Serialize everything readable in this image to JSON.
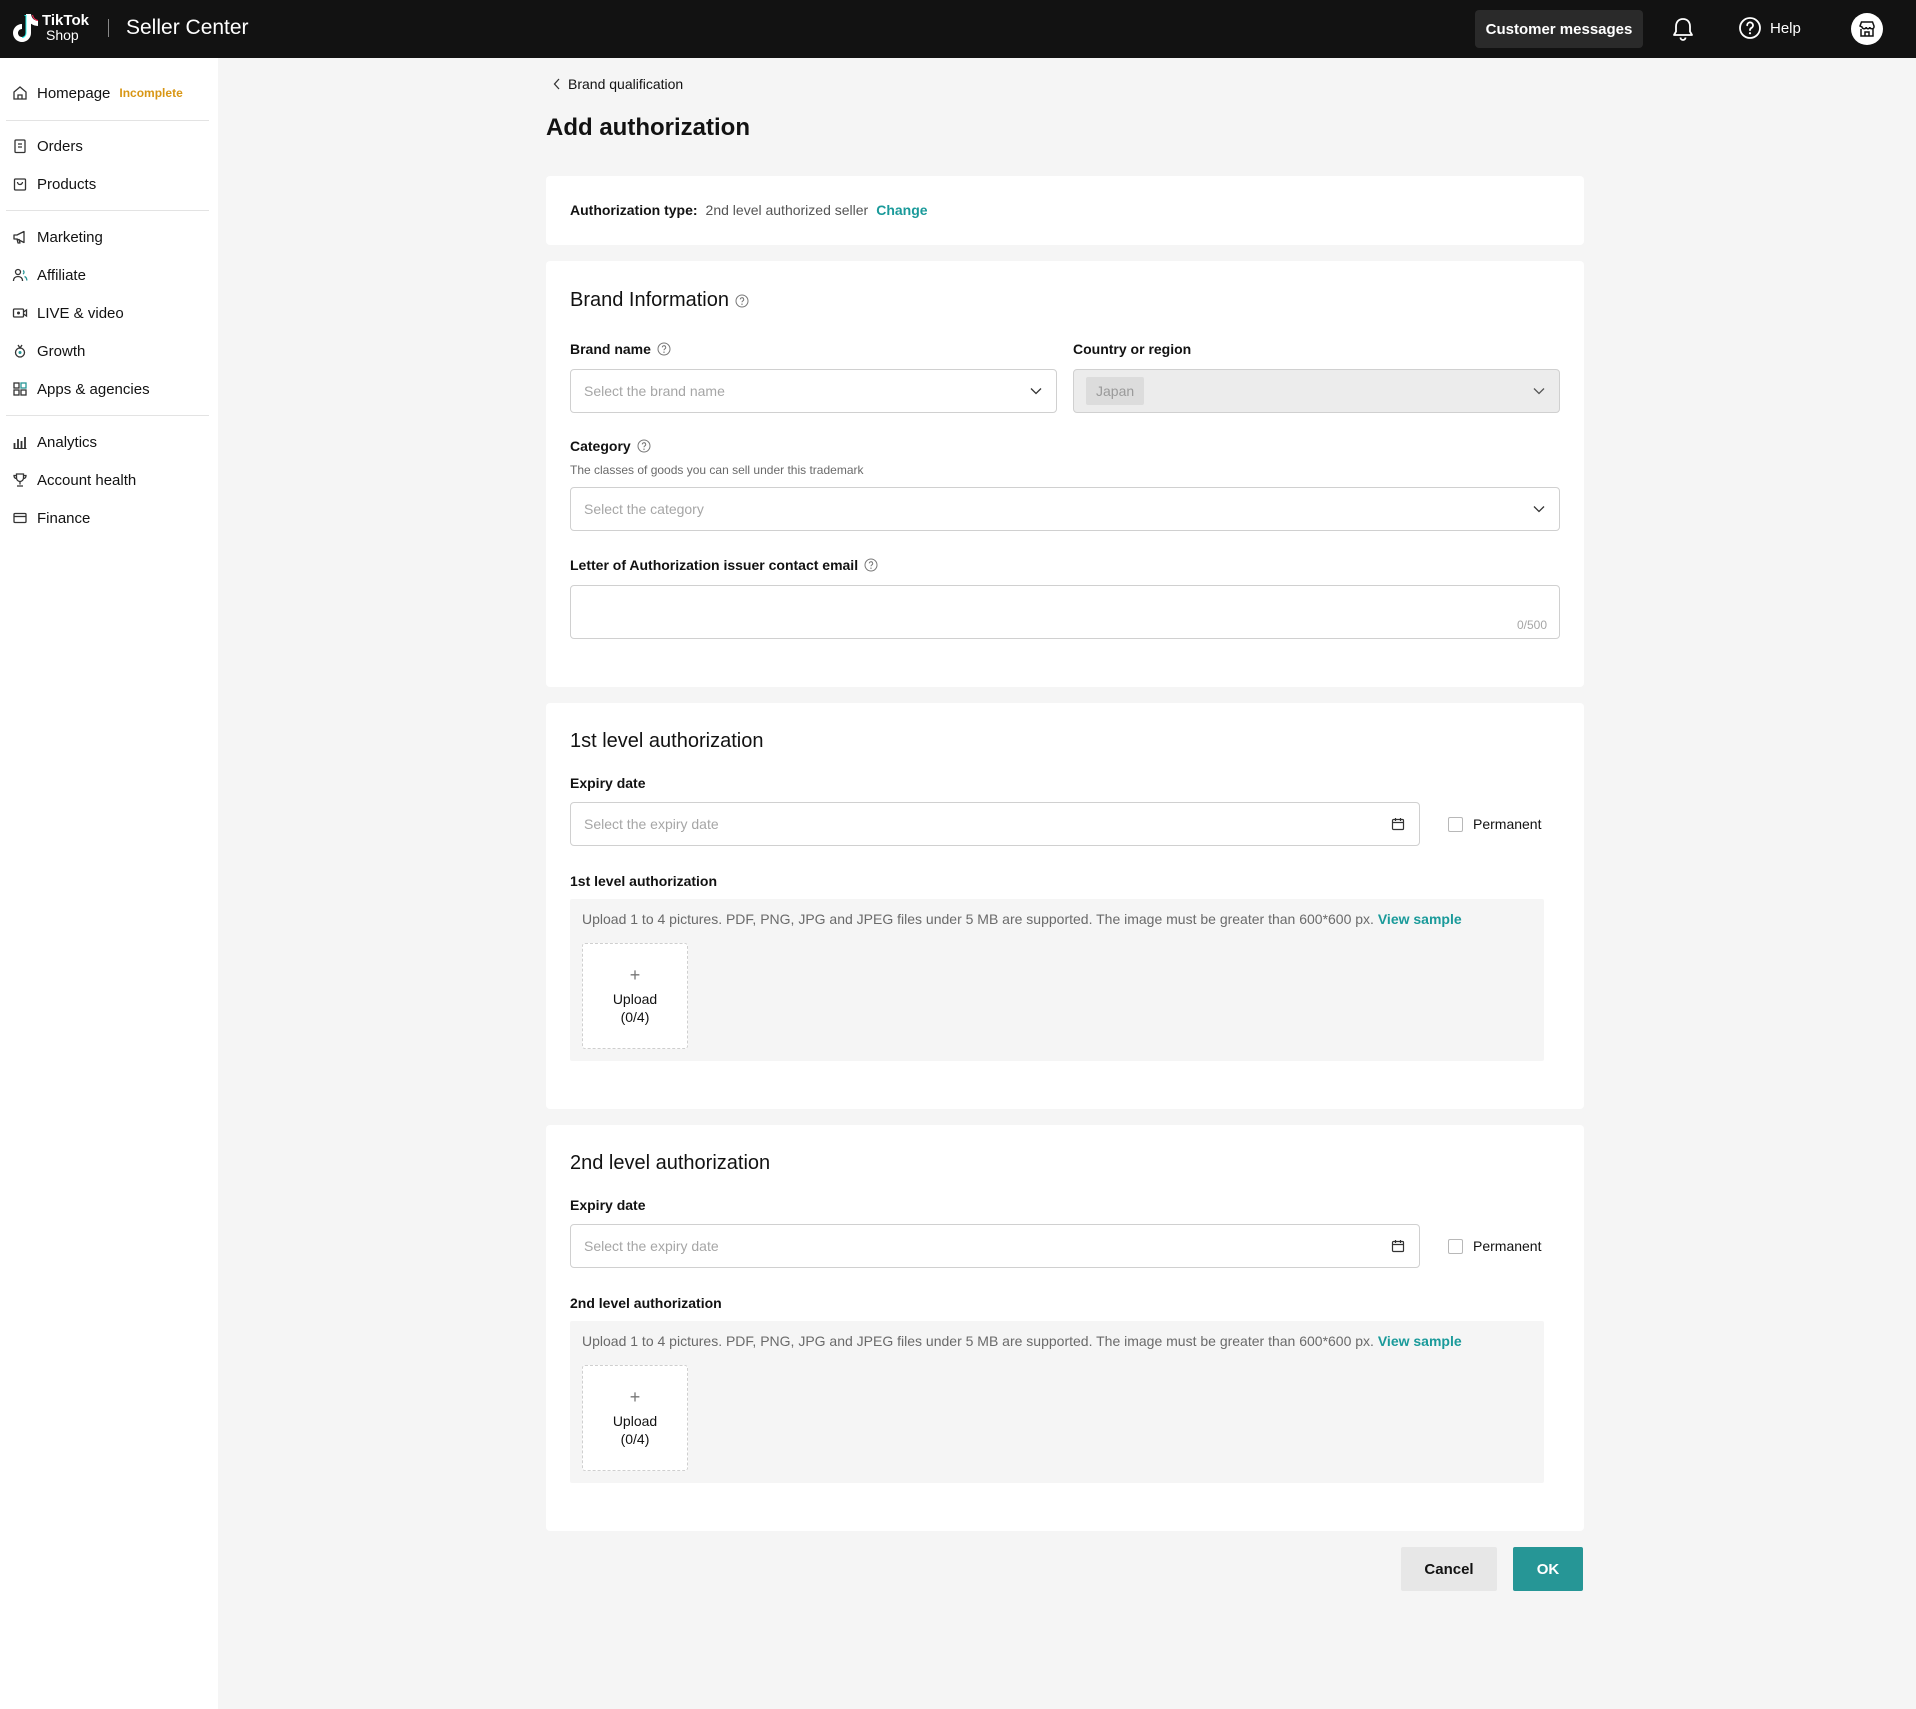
{
  "topbar": {
    "logo_line1": "TikTok",
    "logo_line2": "Shop",
    "app_name": "Seller Center",
    "customer_messages": "Customer messages",
    "help": "Help",
    "icons": [
      "bell-icon",
      "help-icon",
      "store-icon"
    ]
  },
  "sidebar": {
    "homepage": "Homepage",
    "homepage_badge": "Incomplete",
    "items": [
      "Orders",
      "Products",
      "Marketing",
      "Affiliate",
      "LIVE & video",
      "Growth",
      "Apps & agencies",
      "Analytics",
      "Account health",
      "Finance"
    ]
  },
  "page": {
    "breadcrumb": "Brand qualification",
    "title": "Add authorization"
  },
  "auth_type": {
    "label": "Authorization type:",
    "value": "2nd level authorized seller",
    "change": "Change"
  },
  "brand_info": {
    "title": "Brand Information",
    "brand_name_label": "Brand name",
    "brand_name_placeholder": "Select the brand name",
    "country_label": "Country or region",
    "country_value": "Japan",
    "category_label": "Category",
    "category_hint": "The classes of goods you can sell under this trademark",
    "category_placeholder": "Select the category",
    "email_label": "Letter of Authorization issuer contact email",
    "email_counter": "0/500"
  },
  "level1": {
    "title": "1st level authorization",
    "expiry_label": "Expiry date",
    "expiry_placeholder": "Select the expiry date",
    "permanent": "Permanent",
    "upload_label": "1st level authorization",
    "upload_note": "Upload 1 to 4 pictures. PDF, PNG, JPG and JPEG files under 5 MB are supported. The image must be greater than 600*600 px.",
    "view_sample": "View sample",
    "upload_plus": "+",
    "upload_text": "Upload",
    "upload_count": "(0/4)"
  },
  "level2": {
    "title": "2nd level authorization",
    "expiry_label": "Expiry date",
    "expiry_placeholder": "Select the expiry date",
    "permanent": "Permanent",
    "upload_label": "2nd level authorization",
    "upload_note": "Upload 1 to 4 pictures. PDF, PNG, JPG and JPEG files under 5 MB are supported. The image must be greater than 600*600 px.",
    "view_sample": "View sample",
    "upload_plus": "+",
    "upload_text": "Upload",
    "upload_count": "(0/4)"
  },
  "actions": {
    "cancel": "Cancel",
    "ok": "OK"
  },
  "colors": {
    "accent": "#269696",
    "badge": "#d89614",
    "topbar": "#121212"
  }
}
